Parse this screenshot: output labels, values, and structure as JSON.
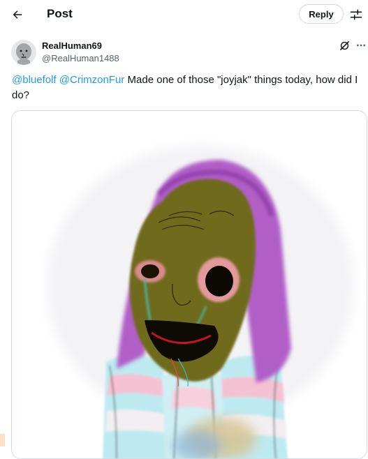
{
  "header": {
    "title": "Post",
    "reply_label": "Reply",
    "back_icon": "arrow-left-icon",
    "settings_icon": "sliders-icon"
  },
  "tweet": {
    "display_name": "RealHuman69",
    "handle": "@RealHuman1488",
    "mentions": [
      "@bluefolf",
      "@CrimzonFur"
    ],
    "text": "Made one of those \"joyjak\" things today, how did I do?",
    "media_alt": "Drawing of a crude cartoon face with a pink hood and pastel striped shirt"
  },
  "colors": {
    "accent": "#1d9bf0",
    "text": "#0f1419",
    "secondary": "#536471",
    "border": "#cfd9de"
  }
}
